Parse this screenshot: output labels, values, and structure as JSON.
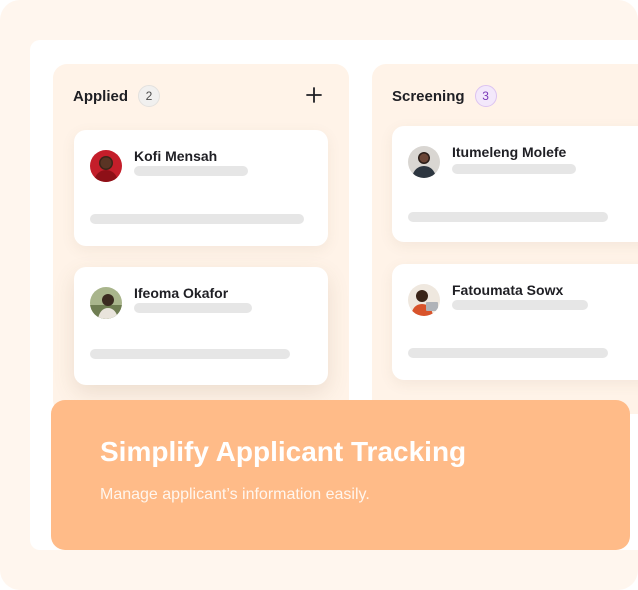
{
  "board": {
    "columns": [
      {
        "title": "Applied",
        "count": "2",
        "cards": [
          {
            "name": "Kofi Mensah",
            "avatar_icon": "person-avatar-red"
          },
          {
            "name": "Ifeoma Okafor",
            "avatar_icon": "person-avatar-green"
          }
        ]
      },
      {
        "title": "Screening",
        "count": "3",
        "cards": [
          {
            "name": "Itumeleng Molefe",
            "avatar_icon": "person-avatar-dark"
          },
          {
            "name": "Fatoumata Sowx",
            "avatar_icon": "person-avatar-orange"
          }
        ]
      }
    ]
  },
  "banner": {
    "title": "Simplify Applicant Tracking",
    "subtitle": "Manage applicant’s information easily."
  },
  "colors": {
    "background": "#fff6ee",
    "column": "#fff3e8",
    "banner": "#ffbb88",
    "screening_badge": "#7a38b8"
  }
}
